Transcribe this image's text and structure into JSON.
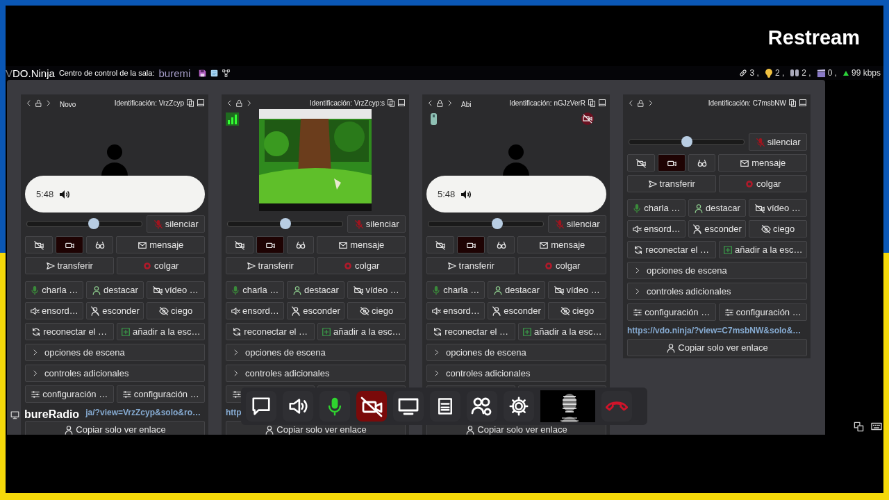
{
  "logo": "Restream",
  "header": {
    "brand_prefix": "V",
    "brand": "DO.Ninja",
    "room_label": "Centro de control de la sala:",
    "room_name": "buremi",
    "stats": [
      {
        "kind": "links",
        "value": "3 ,"
      },
      {
        "kind": "ear",
        "value": "2 ,"
      },
      {
        "kind": "viewers",
        "value": "2 ,"
      },
      {
        "kind": "scenes",
        "value": "0 ,"
      },
      {
        "kind": "bitrate",
        "value": "99 kbps"
      }
    ]
  },
  "cards": [
    {
      "label": "Novo",
      "id_text": "Identificación: VrzZcyp",
      "signal": false,
      "battery": false,
      "video_muted": false,
      "media": {
        "kind": "avatar",
        "time": "5:48"
      },
      "rows": [
        [
          {
            "kind": "slider",
            "level": 0.58
          },
          {
            "kind": "mute",
            "label": "silenciar"
          }
        ],
        [
          {
            "kind": "video-toggle",
            "on": false
          },
          {
            "kind": "camera-toggle",
            "on": true
          },
          {
            "kind": "glasses-toggle",
            "on": false
          },
          {
            "kind": "message",
            "label": "mensaje"
          }
        ],
        [
          {
            "kind": "transfer",
            "label": "transferir"
          },
          {
            "kind": "hangup",
            "label": "colgar"
          }
        ],
        [
          {
            "kind": "talk",
            "label": "charla …"
          },
          {
            "kind": "highlight",
            "label": "destacar"
          },
          {
            "kind": "video-mute",
            "label": "vídeo …"
          }
        ],
        [
          {
            "kind": "deafen",
            "label": "ensord…"
          },
          {
            "kind": "hide",
            "label": "esconder"
          },
          {
            "kind": "blind",
            "label": "ciego"
          }
        ],
        [
          {
            "kind": "reconnect",
            "label": "reconectar el …"
          },
          {
            "kind": "add-scene",
            "label": "añadir a la esc…"
          }
        ],
        [
          {
            "kind": "expander",
            "label": "opciones de escena",
            "expanded": false
          }
        ],
        [
          {
            "kind": "expander",
            "label": "controles adicionales",
            "expanded": false
          }
        ],
        [
          {
            "kind": "settings",
            "label": "configuración …"
          },
          {
            "kind": "settings",
            "label": "configuración …"
          }
        ]
      ],
      "link": "ja/?view=VrzZcyp&solo&ro…",
      "link_covered_start": true,
      "copy_label": "Copiar solo ver enlace"
    },
    {
      "id_text": "Identificación: VrzZcyp:s",
      "signal": true,
      "battery": false,
      "video_muted": false,
      "media": {
        "kind": "picture"
      },
      "rows": [
        [
          {
            "kind": "slider",
            "level": 0.5
          },
          {
            "kind": "mute",
            "label": "silenciar"
          }
        ],
        [
          {
            "kind": "video-toggle",
            "on": false
          },
          {
            "kind": "camera-toggle",
            "on": true
          },
          {
            "kind": "glasses-toggle",
            "on": false
          },
          {
            "kind": "message",
            "label": "mensaje"
          }
        ],
        [
          {
            "kind": "transfer",
            "label": "transferir"
          },
          {
            "kind": "hangup",
            "label": "colgar"
          }
        ],
        [
          {
            "kind": "talk",
            "label": "charla …"
          },
          {
            "kind": "highlight",
            "label": "destacar"
          },
          {
            "kind": "video-mute",
            "label": "vídeo …"
          }
        ],
        [
          {
            "kind": "deafen",
            "label": "ensord…"
          },
          {
            "kind": "hide",
            "label": "esconder"
          },
          {
            "kind": "blind",
            "label": "ciego"
          }
        ],
        [
          {
            "kind": "reconnect",
            "label": "reconectar el …"
          },
          {
            "kind": "add-scene",
            "label": "añadir a la esc…"
          }
        ],
        [
          {
            "kind": "expander",
            "label": "opciones de escena",
            "expanded": false
          }
        ],
        [
          {
            "kind": "expander",
            "label": "controles adicionales",
            "expanded": false
          }
        ],
        [
          {
            "kind": "settings"
          },
          {
            "kind": "settings",
            "covered": true
          }
        ]
      ],
      "link": "http",
      "copy_label": "Copiar solo ver enlace"
    },
    {
      "label": "Abi",
      "id_text": "Identificación: nGJzVerR",
      "signal": false,
      "battery": true,
      "video_muted": true,
      "media": {
        "kind": "avatar",
        "time": "5:48"
      },
      "rows": [
        [
          {
            "kind": "slider",
            "level": 0.6
          },
          {
            "kind": "mute",
            "label": "silenciar"
          }
        ],
        [
          {
            "kind": "video-toggle",
            "on": false
          },
          {
            "kind": "camera-toggle",
            "on": true
          },
          {
            "kind": "glasses-toggle",
            "on": false
          },
          {
            "kind": "message",
            "label": "mensaje"
          }
        ],
        [
          {
            "kind": "transfer",
            "label": "transferir"
          },
          {
            "kind": "hangup",
            "label": "colgar"
          }
        ],
        [
          {
            "kind": "talk",
            "label": "charla …"
          },
          {
            "kind": "highlight",
            "label": "destacar"
          },
          {
            "kind": "video-mute",
            "label": "vídeo …"
          }
        ],
        [
          {
            "kind": "deafen",
            "label": "ensord…"
          },
          {
            "kind": "hide",
            "label": "esconder"
          },
          {
            "kind": "blind",
            "label": "ciego"
          }
        ],
        [
          {
            "kind": "reconnect",
            "label": "reconectar el …"
          },
          {
            "kind": "add-scene",
            "label": "añadir a la esc…"
          }
        ],
        [
          {
            "kind": "expander",
            "label": "opciones de escena",
            "expanded": false
          }
        ],
        [
          {
            "kind": "expander",
            "label": "controles adicionales",
            "expanded": false
          }
        ],
        [
          {
            "kind": "settings",
            "covered": true
          },
          {
            "kind": "settings",
            "covered": true
          }
        ]
      ],
      "copy_label": "Copiar solo ver enlace"
    },
    {
      "id_text": "Identificación: C7msbNW",
      "signal": false,
      "battery": false,
      "video_muted": false,
      "media": {
        "kind": "none"
      },
      "rows": [
        [
          {
            "kind": "slider",
            "level": 0.5
          },
          {
            "kind": "mute",
            "label": "silenciar"
          }
        ],
        [
          {
            "kind": "video-toggle",
            "on": false
          },
          {
            "kind": "camera-toggle",
            "on": true
          },
          {
            "kind": "glasses-toggle",
            "on": false
          },
          {
            "kind": "message",
            "label": "mensaje"
          }
        ],
        [
          {
            "kind": "transfer",
            "label": "transferir"
          },
          {
            "kind": "hangup",
            "label": "colgar"
          }
        ],
        [
          {
            "kind": "talk",
            "label": "charla …"
          },
          {
            "kind": "highlight",
            "label": "destacar"
          },
          {
            "kind": "video-mute",
            "label": "vídeo …"
          }
        ],
        [
          {
            "kind": "deafen",
            "label": "ensord…"
          },
          {
            "kind": "hide",
            "label": "esconder"
          },
          {
            "kind": "blind",
            "label": "ciego"
          }
        ],
        [
          {
            "kind": "reconnect",
            "label": "reconectar el …"
          },
          {
            "kind": "add-scene",
            "label": "añadir a la esc…"
          }
        ],
        [
          {
            "kind": "expander",
            "label": "opciones de escena",
            "expanded": false
          }
        ],
        [
          {
            "kind": "expander",
            "label": "controles adicionales",
            "expanded": false
          }
        ],
        [
          {
            "kind": "settings",
            "label": "configuración …"
          },
          {
            "kind": "settings",
            "label": "configuración …"
          }
        ]
      ],
      "link": "https://vdo.ninja/?view=C7msbNW&solo&…",
      "copy_label": "Copiar solo ver enlace"
    }
  ],
  "overlay_label": "bureRadio",
  "toolbar": [
    {
      "kind": "chat"
    },
    {
      "kind": "speaker"
    },
    {
      "kind": "mic",
      "on": true
    },
    {
      "kind": "camera",
      "on": false
    },
    {
      "kind": "screen"
    },
    {
      "kind": "window"
    },
    {
      "kind": "group"
    },
    {
      "kind": "settings"
    },
    {
      "kind": "preview"
    },
    {
      "kind": "hangup"
    }
  ]
}
